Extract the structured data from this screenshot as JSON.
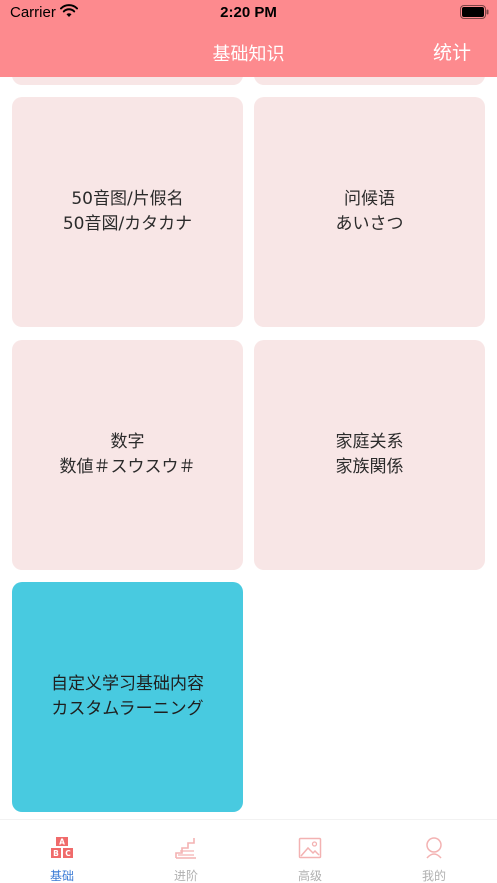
{
  "status_bar": {
    "carrier": "Carrier",
    "time": "2:20 PM"
  },
  "nav": {
    "title": "基础知识",
    "right_button": "统计"
  },
  "cards": [
    {
      "line1": "50音图/片假名",
      "line2": "50音図/カタカナ"
    },
    {
      "line1": "问候语",
      "line2": "あいさつ"
    },
    {
      "line1": "数字",
      "line2": "数値＃スウスウ＃"
    },
    {
      "line1": "家庭关系",
      "line2": "家族関係"
    },
    {
      "line1": "自定义学习基础内容",
      "line2": "カスタムラーニング"
    }
  ],
  "tabs": [
    {
      "label": "基础",
      "icon": "abc-blocks-icon",
      "active": true
    },
    {
      "label": "进阶",
      "icon": "stairs-icon",
      "active": false
    },
    {
      "label": "高级",
      "icon": "image-icon",
      "active": false
    },
    {
      "label": "我的",
      "icon": "person-icon",
      "active": false
    }
  ],
  "colors": {
    "header": "#fd8a8e",
    "card": "#f8e6e6",
    "custom_card": "#48cae0",
    "tab_active": "#3a7bd5",
    "tab_inactive": "#b0b0b0"
  }
}
